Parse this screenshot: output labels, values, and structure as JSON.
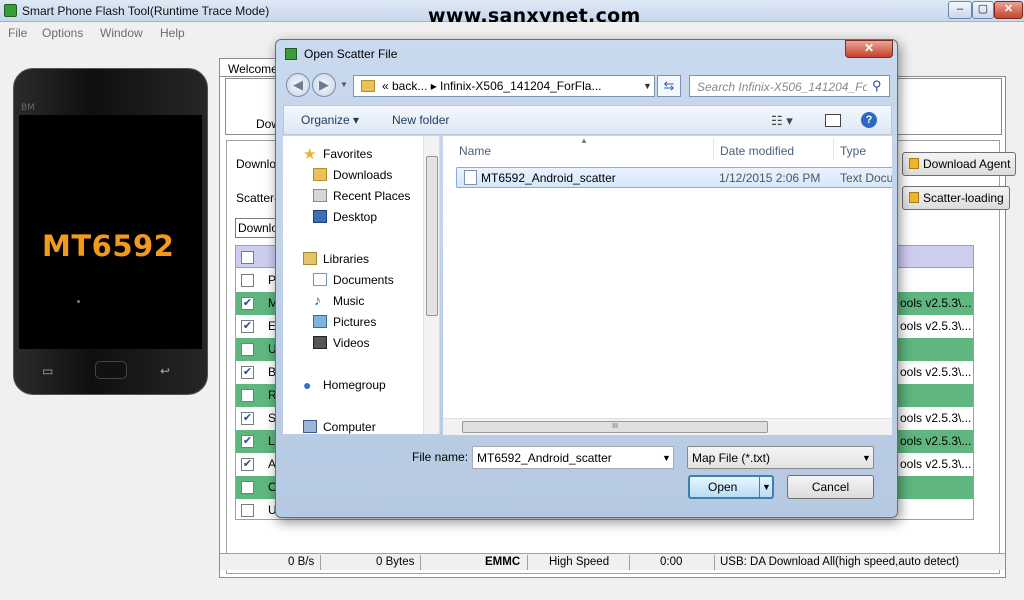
{
  "window": {
    "title": "Smart Phone Flash Tool(Runtime Trace Mode)",
    "watermark": "www.sanxynet.com",
    "minimize": "–",
    "maximize": "▢",
    "close": "✕"
  },
  "menu": [
    "File",
    "Options",
    "Window",
    "Help"
  ],
  "phone": {
    "speaker_label": "BM",
    "chip": "MT6592"
  },
  "tool": {
    "welcome_tab": "Welcome",
    "top_label": "Dow",
    "download_label": "Downloa",
    "scatter_label": "Scatter-",
    "download_combo": "Downloa",
    "download_agent_button": "Download Agent",
    "scatter_loading_button": "Scatter-loading"
  },
  "partitions": [
    {
      "name": "P",
      "checked": false,
      "highlight": false,
      "location": ""
    },
    {
      "name": "M",
      "checked": true,
      "highlight": true,
      "location": "ools v2.5.3\\..."
    },
    {
      "name": "E",
      "checked": true,
      "highlight": false,
      "location": "ools v2.5.3\\..."
    },
    {
      "name": "U",
      "checked": false,
      "highlight": true,
      "location": ""
    },
    {
      "name": "B",
      "checked": true,
      "highlight": false,
      "location": "ools v2.5.3\\..."
    },
    {
      "name": "R",
      "checked": false,
      "highlight": true,
      "location": ""
    },
    {
      "name": "S",
      "checked": true,
      "highlight": false,
      "location": "ools v2.5.3\\..."
    },
    {
      "name": "L",
      "checked": true,
      "highlight": true,
      "location": "ools v2.5.3\\..."
    },
    {
      "name": "A",
      "checked": true,
      "highlight": false,
      "location": "ools v2.5.3\\..."
    },
    {
      "name": "C",
      "checked": false,
      "highlight": true,
      "location": ""
    },
    {
      "name": "U",
      "checked": false,
      "highlight": false,
      "location": ""
    }
  ],
  "status": {
    "speed": "0 B/s",
    "bytes": "0 Bytes",
    "storage": "EMMC",
    "mode": "High Speed",
    "time": "0:00",
    "usb": "USB: DA Download All(high speed,auto detect)"
  },
  "dialog": {
    "title": "Open Scatter File",
    "close": "✕",
    "address": "« back...  ▸  Infinix-X506_141204_ForFla...",
    "search_placeholder": "Search Infinix-X506_141204_Fo...",
    "organize": "Organize ▾",
    "new_folder": "New folder",
    "nav": {
      "favorites": "Favorites",
      "downloads": "Downloads",
      "recent": "Recent Places",
      "desktop": "Desktop",
      "libraries": "Libraries",
      "documents": "Documents",
      "music": "Music",
      "pictures": "Pictures",
      "videos": "Videos",
      "homegroup": "Homegroup",
      "computer": "Computer"
    },
    "columns": {
      "name": "Name",
      "date": "Date modified",
      "type": "Type"
    },
    "file": {
      "name": "MT6592_Android_scatter",
      "date": "1/12/2015 2:06 PM",
      "type": "Text Docu"
    },
    "filename_label": "File name:",
    "filename_value": "MT6592_Android_scatter",
    "filter": "Map File (*.txt)",
    "open": "Open",
    "cancel": "Cancel"
  }
}
